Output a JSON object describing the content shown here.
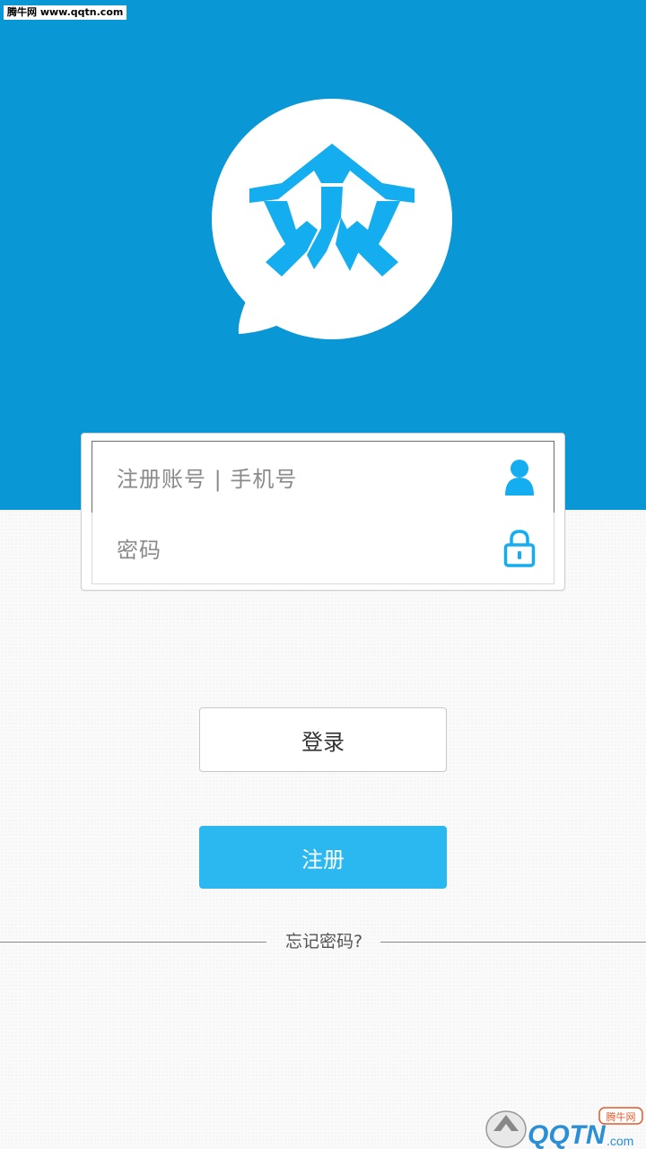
{
  "watermark": {
    "top_text": "腾牛网 www.qqtn.com",
    "bottom_brand": "QQTN",
    "bottom_suffix": ".com",
    "bottom_tag": "腾牛网"
  },
  "app": {
    "logo_icon": "speech-bubble-zhong-logo",
    "brand_color": "#0a97d6",
    "accent_color": "#2bb8f1"
  },
  "login": {
    "account_placeholder": "注册账号 | 手机号",
    "password_placeholder": "密码",
    "account_icon": "user-icon",
    "password_icon": "lock-icon",
    "login_label": "登录",
    "register_label": "注册",
    "forgot_label": "忘记密码?"
  }
}
